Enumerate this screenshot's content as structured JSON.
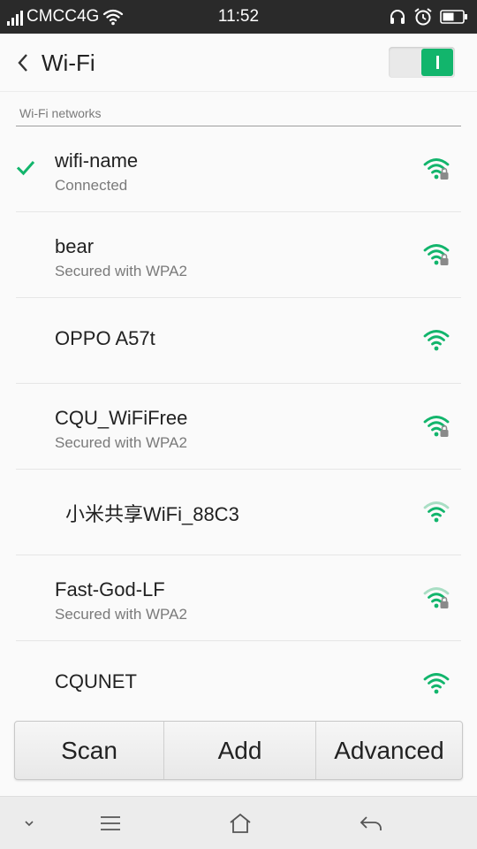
{
  "status_bar": {
    "carrier": "CMCC4G",
    "time": "11:52",
    "icons": [
      "signal-icon",
      "wifi-icon",
      "headphones-icon",
      "alarm-icon",
      "battery-icon"
    ]
  },
  "header": {
    "title": "Wi-Fi",
    "wifi_enabled": true
  },
  "section_label": "Wi-Fi networks",
  "networks": [
    {
      "name": "wifi-name",
      "status": "Connected",
      "connected": true,
      "secured": true
    },
    {
      "name": "bear",
      "status": "Secured with WPA2",
      "connected": false,
      "secured": true
    },
    {
      "name": "OPPO A57t",
      "status": "",
      "connected": false,
      "secured": false
    },
    {
      "name": "CQU_WiFiFree",
      "status": "Secured with WPA2",
      "connected": false,
      "secured": true
    },
    {
      "name": "小米共享WiFi_88C3",
      "status": "",
      "connected": false,
      "secured": false
    },
    {
      "name": "Fast-God-LF",
      "status": "Secured with WPA2",
      "connected": false,
      "secured": true
    },
    {
      "name": "CQUNET",
      "status": "",
      "connected": false,
      "secured": false
    }
  ],
  "actions": {
    "scan": "Scan",
    "add": "Add",
    "advanced": "Advanced"
  },
  "colors": {
    "accent": "#12b56c",
    "status_bar": "#2a2a2a"
  }
}
